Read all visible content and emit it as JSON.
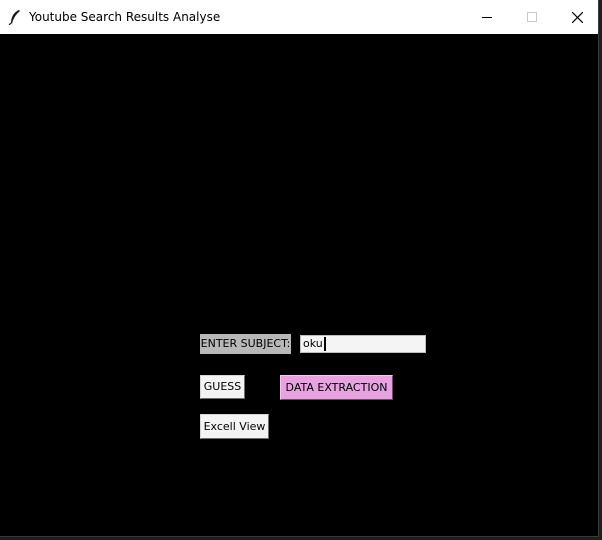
{
  "window": {
    "title": "Youtube Search Results Analyse",
    "icon": "feather-icon",
    "controls": {
      "minimize": "minimize-icon",
      "maximize": "maximize-icon",
      "close": "close-icon"
    }
  },
  "form": {
    "subject_label": "ENTER SUBJECT:",
    "subject_value": "oku",
    "guess_label": "GUESS",
    "extract_label": "DATA EXTRACTION",
    "excel_label": "Excell View"
  },
  "colors": {
    "background": "#000000",
    "titlebar": "#ffffff",
    "label_bg": "#b8b8b8",
    "extract_button_bg": "#e8a2e0",
    "button_bg": "#f4f4f4"
  }
}
